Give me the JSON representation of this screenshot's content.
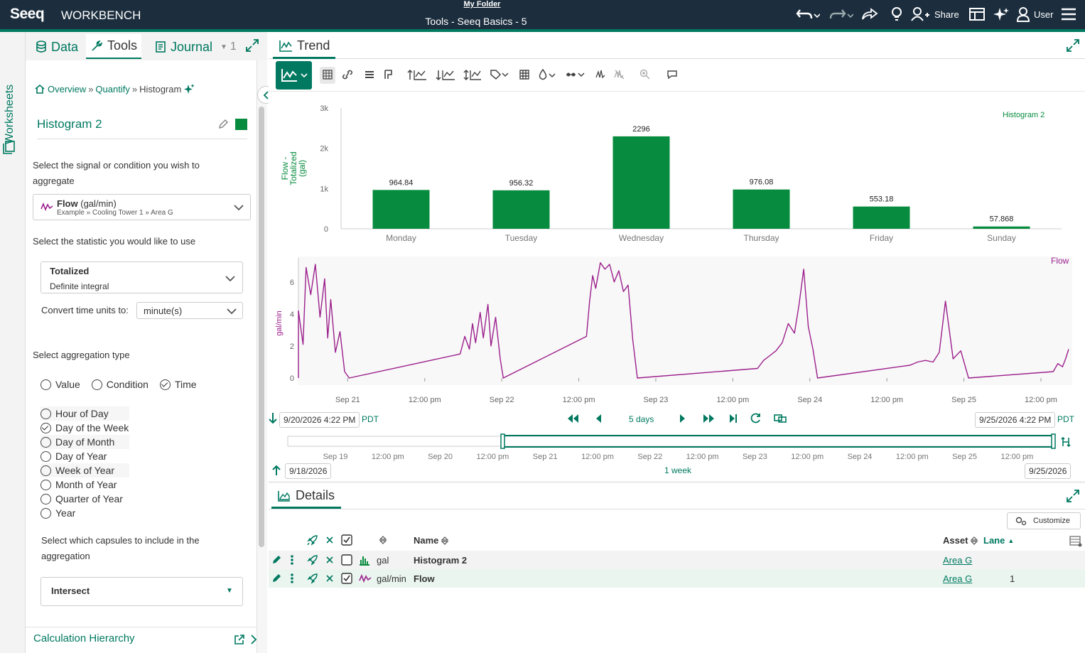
{
  "app": {
    "logo": "Seeq",
    "product": "WORKBENCH",
    "folder": "My Folder",
    "title": "Tools - Seeq Basics - 5",
    "share": "Share",
    "user": "User"
  },
  "sidebar": {
    "worksheets": "Worksheets"
  },
  "left_tabs": {
    "data": "Data",
    "tools": "Tools",
    "journal": "Journal",
    "count": "1"
  },
  "breadcrumb": {
    "overview": "Overview",
    "quantify": "Quantify",
    "current": "Histogram"
  },
  "tool": {
    "name": "Histogram 2",
    "color": "#078c3f",
    "signal_prompt": "Select the signal or condition you wish to aggregate",
    "signal": {
      "name": "Flow",
      "unit": "(gal/min)",
      "path": "Example » Cooling Tower 1 » Area G"
    },
    "stat_prompt": "Select the statistic you would like to use",
    "stat": {
      "name": "Totalized",
      "desc": "Definite integral"
    },
    "convert_label": "Convert time units to:",
    "convert_value": "minute(s)",
    "agg_prompt": "Select aggregation type",
    "agg_types": [
      {
        "label": "Value",
        "on": false
      },
      {
        "label": "Condition",
        "on": false
      },
      {
        "label": "Time",
        "on": true
      }
    ],
    "time_options": [
      {
        "label": "Hour of Day",
        "on": false
      },
      {
        "label": "Day of the Week",
        "on": true
      },
      {
        "label": "Day of Month",
        "on": false
      },
      {
        "label": "Day of Year",
        "on": false
      },
      {
        "label": "Week of Year",
        "on": false
      },
      {
        "label": "Month of Year",
        "on": false
      },
      {
        "label": "Quarter of Year",
        "on": false
      },
      {
        "label": "Year",
        "on": false
      }
    ],
    "capsule_prompt": "Select which capsules to include in the aggregation",
    "capsule_value": "Intersect",
    "calc_hierarchy": "Calculation Hierarchy"
  },
  "trend": {
    "tab": "Trend",
    "histogram_legend": "Histogram 2",
    "flow_legend": "Flow",
    "start": "9/20/2026 4:22 PM",
    "end": "9/25/2026 4:22 PM",
    "tz": "PDT",
    "duration": "5 days",
    "nav_start": "9/18/2026",
    "nav_end": "9/25/2026",
    "nav_duration": "1 week",
    "time_ticks": [
      "Sep 21",
      "12:00 pm",
      "Sep 22",
      "12:00 pm",
      "Sep 23",
      "12:00 pm",
      "Sep 24",
      "12:00 pm",
      "Sep 25",
      "12:00 pm"
    ],
    "nav_ticks": [
      "Sep 19",
      "12:00 pm",
      "Sep 20",
      "12:00 pm",
      "Sep 21",
      "12:00 pm",
      "Sep 22",
      "12:00 pm",
      "Sep 23",
      "12:00 pm",
      "Sep 24",
      "12:00 pm",
      "Sep 25",
      "12:00 pm"
    ]
  },
  "chart_data": [
    {
      "type": "bar",
      "categories": [
        "Monday",
        "Tuesday",
        "Wednesday",
        "Thursday",
        "Friday",
        "Sunday"
      ],
      "values": [
        964.84,
        956.32,
        2296,
        976.08,
        553.18,
        57.868
      ],
      "value_labels": [
        "964.84",
        "956.32",
        "2296",
        "976.08",
        "553.18",
        "57.868"
      ],
      "ylabel": "Flow - Totalized (gal)",
      "yticks": [
        "0",
        "1k",
        "2k",
        "3k"
      ],
      "ylim": [
        0,
        3000
      ],
      "legend": "Histogram 2",
      "color": "#078c3f"
    },
    {
      "type": "line",
      "ylabel": "gal/min",
      "yticks": [
        "0",
        "2",
        "4",
        "6"
      ],
      "ylim": [
        0,
        7.5
      ],
      "legend": "Flow",
      "color": "#9b1f8c",
      "x_unit": "days from Sep 20 4:22 PM",
      "segments": [
        {
          "x": [
            0.0,
            0.03,
            0.05,
            0.08,
            0.11,
            0.14,
            0.17,
            0.19,
            0.21,
            0.24,
            0.27,
            0.3,
            0.33
          ],
          "y": [
            4.2,
            2.1,
            6.9,
            5.2,
            7.1,
            3.8,
            6.2,
            2.5,
            4.9,
            1.6,
            2.9,
            0.4,
            0.0
          ]
        },
        {
          "x": [
            1.05,
            1.08,
            1.11,
            1.13,
            1.15,
            1.18,
            1.2,
            1.23,
            1.25,
            1.28,
            1.31,
            1.33
          ],
          "y": [
            1.5,
            2.6,
            1.8,
            3.4,
            2.2,
            4.1,
            2.5,
            4.6,
            2.0,
            3.8,
            1.2,
            0.0
          ]
        },
        {
          "x": [
            1.87,
            1.89,
            1.91,
            1.93,
            1.96,
            1.99,
            2.02,
            2.05,
            2.08,
            2.11,
            2.14,
            2.17,
            2.2
          ],
          "y": [
            2.6,
            4.8,
            6.4,
            5.6,
            7.2,
            6.8,
            7.1,
            6.0,
            6.7,
            5.4,
            5.8,
            2.4,
            0.0
          ]
        },
        {
          "x": [
            2.98,
            3.02,
            3.06,
            3.1,
            3.14,
            3.18,
            3.22,
            3.25,
            3.28,
            3.31,
            3.34,
            3.37
          ],
          "y": [
            0.6,
            1.1,
            1.4,
            1.7,
            2.2,
            3.4,
            2.8,
            4.6,
            6.8,
            3.2,
            1.8,
            0.0
          ]
        },
        {
          "x": [
            3.97,
            4.02,
            4.07,
            4.12,
            4.16,
            4.2,
            4.25,
            4.3,
            4.35
          ],
          "y": [
            0.8,
            1.0,
            1.1,
            1.0,
            1.6,
            4.8,
            1.2,
            1.7,
            0.0
          ]
        },
        {
          "x": [
            4.9,
            4.93,
            4.96,
            4.98,
            5.0
          ],
          "y": [
            0.4,
            0.9,
            0.7,
            1.2,
            1.8
          ]
        }
      ]
    }
  ],
  "details": {
    "tab": "Details",
    "customize": "Customize",
    "headers": {
      "name": "Name",
      "asset": "Asset",
      "lane": "Lane"
    },
    "rows": [
      {
        "unit": "gal",
        "name": "Histogram 2",
        "asset": "Area G",
        "lane": "",
        "checked": false,
        "icon": "bar-chart-icon"
      },
      {
        "unit": "gal/min",
        "name": "Flow",
        "asset": "Area G",
        "lane": "1",
        "checked": true,
        "icon": "signal-icon"
      }
    ]
  }
}
